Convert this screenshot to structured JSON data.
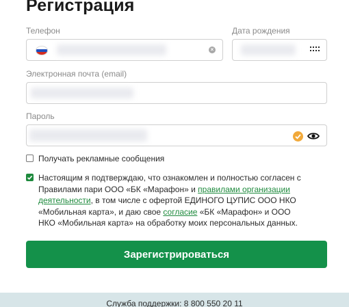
{
  "page": {
    "title": "Регистрация"
  },
  "form": {
    "phone": {
      "label": "Телефон",
      "country_icon": "russia-flag-icon",
      "clear_icon": "clear-icon"
    },
    "birth_date": {
      "label": "Дата рождения",
      "picker_icon": "calendar-grid-icon"
    },
    "email": {
      "label": "Электронная почта (email)"
    },
    "password": {
      "label": "Пароль",
      "valid_icon": "check-badge-icon",
      "toggle_icon": "eye-icon"
    },
    "ads_checkbox": {
      "label": "Получать рекламные сообщения",
      "checked": false
    },
    "consent_checkbox": {
      "checked": true,
      "part1": "Настоящим я подтверждаю, что ознакомлен и полностью согласен с Правилами пари ООО «БК «Марафон» и ",
      "link1": "правилами организации деятельности",
      "part2": ", в том числе с офертой ЕДИНОГО ЦУПИС ООО НКО «Мобильная карта», и даю свое ",
      "link2": "согласие",
      "part3": " «БК «Марафон» и ООО НКО «Мобильная карта» на обработку моих персональных данных."
    },
    "submit_label": "Зарегистрироваться"
  },
  "footer": {
    "support": "Служба поддержки: 8 800 550 20 11"
  },
  "colors": {
    "accent": "#14914a",
    "footer_bg": "#d7e5e8",
    "valid": "#f1a93a"
  }
}
